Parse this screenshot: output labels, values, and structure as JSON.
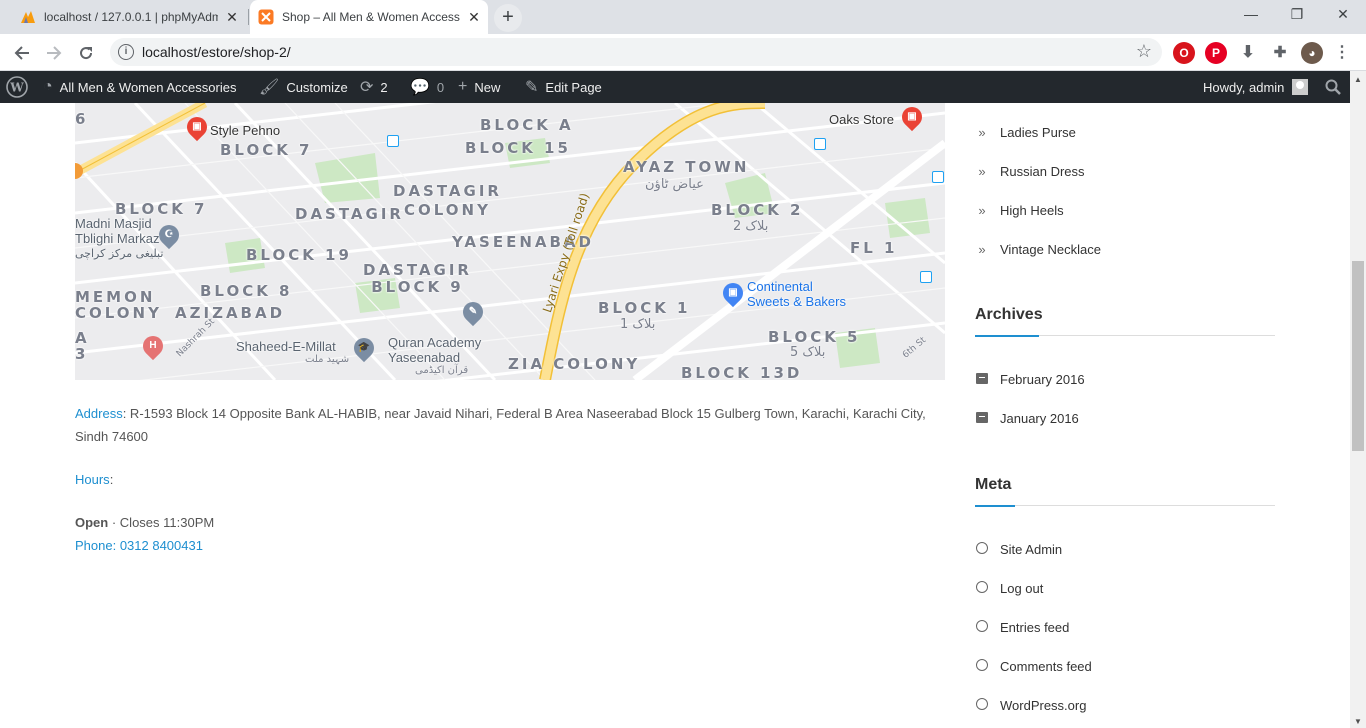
{
  "browser": {
    "tabs": [
      {
        "title": "localhost / 127.0.0.1 | phpMyAdmin",
        "icon": "phpmyadmin-icon",
        "active": false
      },
      {
        "title": "Shop – All Men & Women Accessories",
        "icon": "xampp-icon",
        "active": true
      }
    ],
    "new_tab_label": "+",
    "url": "localhost/estore/shop-2/"
  },
  "adminbar": {
    "site_name": "All Men & Women Accessories",
    "customize": "Customize",
    "updates_count": "2",
    "comments_count": "0",
    "new_label": "New",
    "edit_page": "Edit Page",
    "howdy": "Howdy, admin"
  },
  "map": {
    "labels": {
      "block_a": "BLOCK A",
      "block_15": "BLOCK 15",
      "block_7_top": "BLOCK 7",
      "ayaz_town": "AYAZ TOWN",
      "ayaz_town_urdu": "عیاض ٹاؤن",
      "dastagir_colony": "DASTAGIR\nCOLONY",
      "dastagir": "DASTAGIR",
      "block_7_left": "BLOCK 7",
      "block_2": "BLOCK 2",
      "block_2_urdu": "بلاک 2",
      "yaseenabad": "YASEENABAD",
      "fl_1": "FL 1",
      "block_19": "BLOCK 19",
      "dastagir_block_9": "DASTAGIR\nBLOCK 9",
      "block_8": "BLOCK 8",
      "azizabad": "AZIZABAD",
      "memon_colony": "MEMON\nCOLONY",
      "block_1": "BLOCK 1",
      "block_1_urdu": "بلاک 1",
      "block_5": "BLOCK 5",
      "block_5_urdu": "بلاک 5",
      "zia_colony": "ZIA COLONY",
      "block_13d": "BLOCK 13D",
      "lyari_expy": "Lyari Expy (Toll road)",
      "nashrah_st": "Nashrah St",
      "sixth_st": "6th St",
      "a": "A",
      "three": "3",
      "six": "6"
    },
    "pois": {
      "style_pehno": "Style Pehno",
      "oaks_store": "Oaks Store",
      "madni_masjid": "Madni Masjid\nTblighi Markaz",
      "madni_masjid_urdu": "تبلیغی مرکز کراچی",
      "continental": "Continental\nSweets & Bakers",
      "shaheed_e_millat": "Shaheed-E-Millat",
      "shaheed_urdu": "شہید ملت",
      "quran_academy": "Quran Academy\nYaseenabad",
      "quran_urdu": "قرآن اکیڈمی"
    },
    "colors": {
      "background": "#ececee",
      "road_major": "#fde293",
      "road_major_stroke": "#f2c037",
      "road_minor": "#ffffff",
      "park": "#cde8c4",
      "accent_link": "#1e8fd0"
    }
  },
  "store_info": {
    "address_label": "Address",
    "address_text": ": R-1593 Block 14 Opposite Bank AL-HABIB, near Javaid Nihari, Federal B Area Naseerabad Block 15 Gulberg Town, Karachi, Karachi City, Sindh 74600",
    "hours_label": "Hours",
    "hours_colon": ":",
    "open_label": "Open",
    "closes_text": " · Closes 11:30PM",
    "phone": "Phone: 0312 8400431"
  },
  "sidebar": {
    "categories": [
      "Ladies Purse",
      "Russian Dress",
      "High Heels",
      "Vintage Necklace"
    ],
    "archives_title": "Archives",
    "archives": [
      "February 2016",
      "January 2016"
    ],
    "meta_title": "Meta",
    "meta": [
      "Site Admin",
      "Log out",
      "Entries feed",
      "Comments feed",
      "WordPress.org"
    ]
  }
}
